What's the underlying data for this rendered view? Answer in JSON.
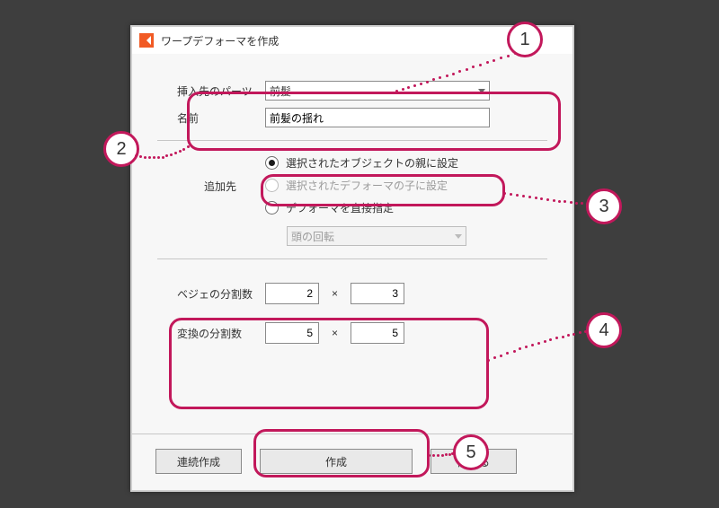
{
  "title": "ワープデフォーマを作成",
  "form": {
    "insert_label": "挿入先のパーツ",
    "insert_value": "前髪",
    "name_label": "名前",
    "name_value": "前髪の揺れ"
  },
  "destination": {
    "section_label": "追加先",
    "opt_parent": "選択されたオブジェクトの親に設定",
    "opt_child": "選択されたデフォーマの子に設定",
    "opt_direct": "デフォーマを直接指定",
    "direct_select_value": "頭の回転"
  },
  "grid": {
    "bezier_label": "ベジェの分割数",
    "bezier_x": "2",
    "bezier_y": "3",
    "conv_label": "変換の分割数",
    "conv_x": "5",
    "conv_y": "5",
    "times": "×"
  },
  "buttons": {
    "continuous": "連続作成",
    "create": "作成",
    "close": "閉じる"
  },
  "callouts": {
    "n1": "1",
    "n2": "2",
    "n3": "3",
    "n4": "4",
    "n5": "5"
  }
}
